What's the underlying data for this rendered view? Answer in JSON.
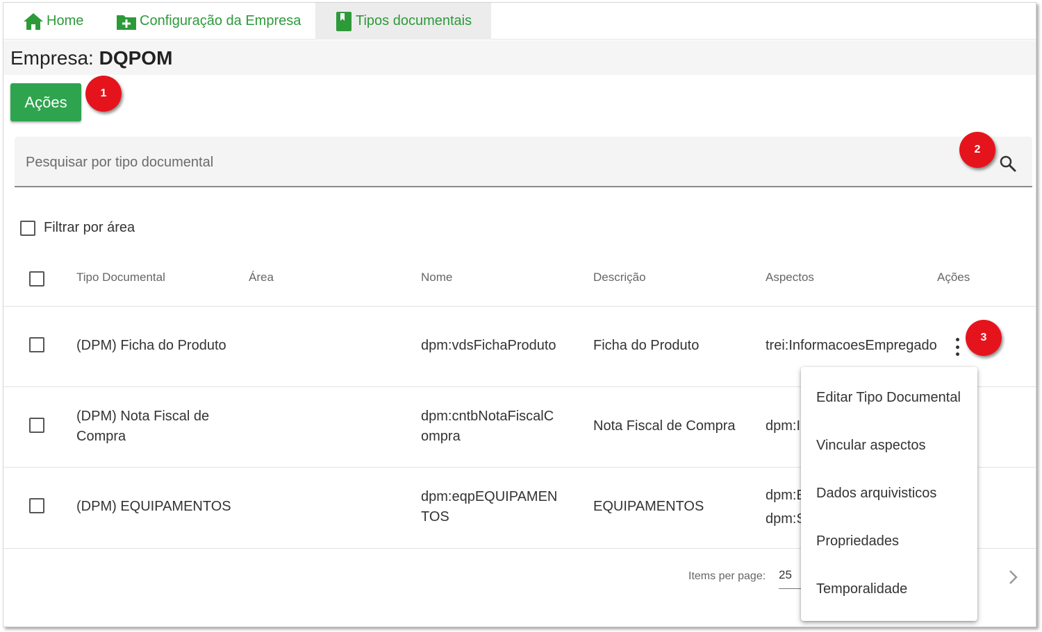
{
  "tabs": {
    "home": "Home",
    "config": "Configuração da Empresa",
    "tipos": "Tipos documentais"
  },
  "company": {
    "prefix": "Empresa:",
    "name": "DQPOM"
  },
  "actions_button": "Ações",
  "search": {
    "placeholder": "Pesquisar por tipo documental"
  },
  "filter": {
    "label": "Filtrar por área"
  },
  "table": {
    "headers": {
      "tipo": "Tipo Documental",
      "area": "Área",
      "nome": "Nome",
      "descricao": "Descrição",
      "aspectos": "Aspectos",
      "acoes": "Ações"
    },
    "rows": [
      {
        "tipo": "(DPM) Ficha do Produto",
        "area": "",
        "nome": "dpm:vdsFichaProduto",
        "descricao": "Ficha do Produto",
        "aspectos": "trei:InformacoesEmpregado"
      },
      {
        "tipo_l1": "(DPM) Nota Fiscal de",
        "tipo_l2": "Compra",
        "area": "",
        "nome_l1": "dpm:cntbNotaFiscalC",
        "nome_l2": "ompra",
        "descricao": "Nota Fiscal de Compra",
        "aspectos": "dpm:I"
      },
      {
        "tipo": "(DPM) EQUIPAMENTOS",
        "area": "",
        "nome_l1": "dpm:eqpEQUIPAMEN",
        "nome_l2": "TOS",
        "descricao": "EQUIPAMENTOS",
        "aspectos_l1": "dpm:E",
        "aspectos_l2": "dpm:S"
      }
    ]
  },
  "context_menu": {
    "items": [
      "Editar Tipo Documental",
      "Vincular aspectos",
      "Dados arquivisticos",
      "Propriedades",
      "Temporalidade"
    ]
  },
  "pagination": {
    "label": "Items per page:",
    "value": "25"
  },
  "markers": [
    "1",
    "2",
    "3"
  ],
  "colors": {
    "brand_green": "#2ea44f",
    "tab_text_green": "#2d9a3a",
    "marker_red": "#e5141c",
    "active_tab_bg": "#ececec"
  },
  "icons": {
    "home": "home-icon",
    "config": "folder-plus-icon",
    "tipos": "bookmark-book-icon",
    "search": "search-icon",
    "kebab": "more-vert-icon",
    "next": "chevron-right-icon"
  }
}
